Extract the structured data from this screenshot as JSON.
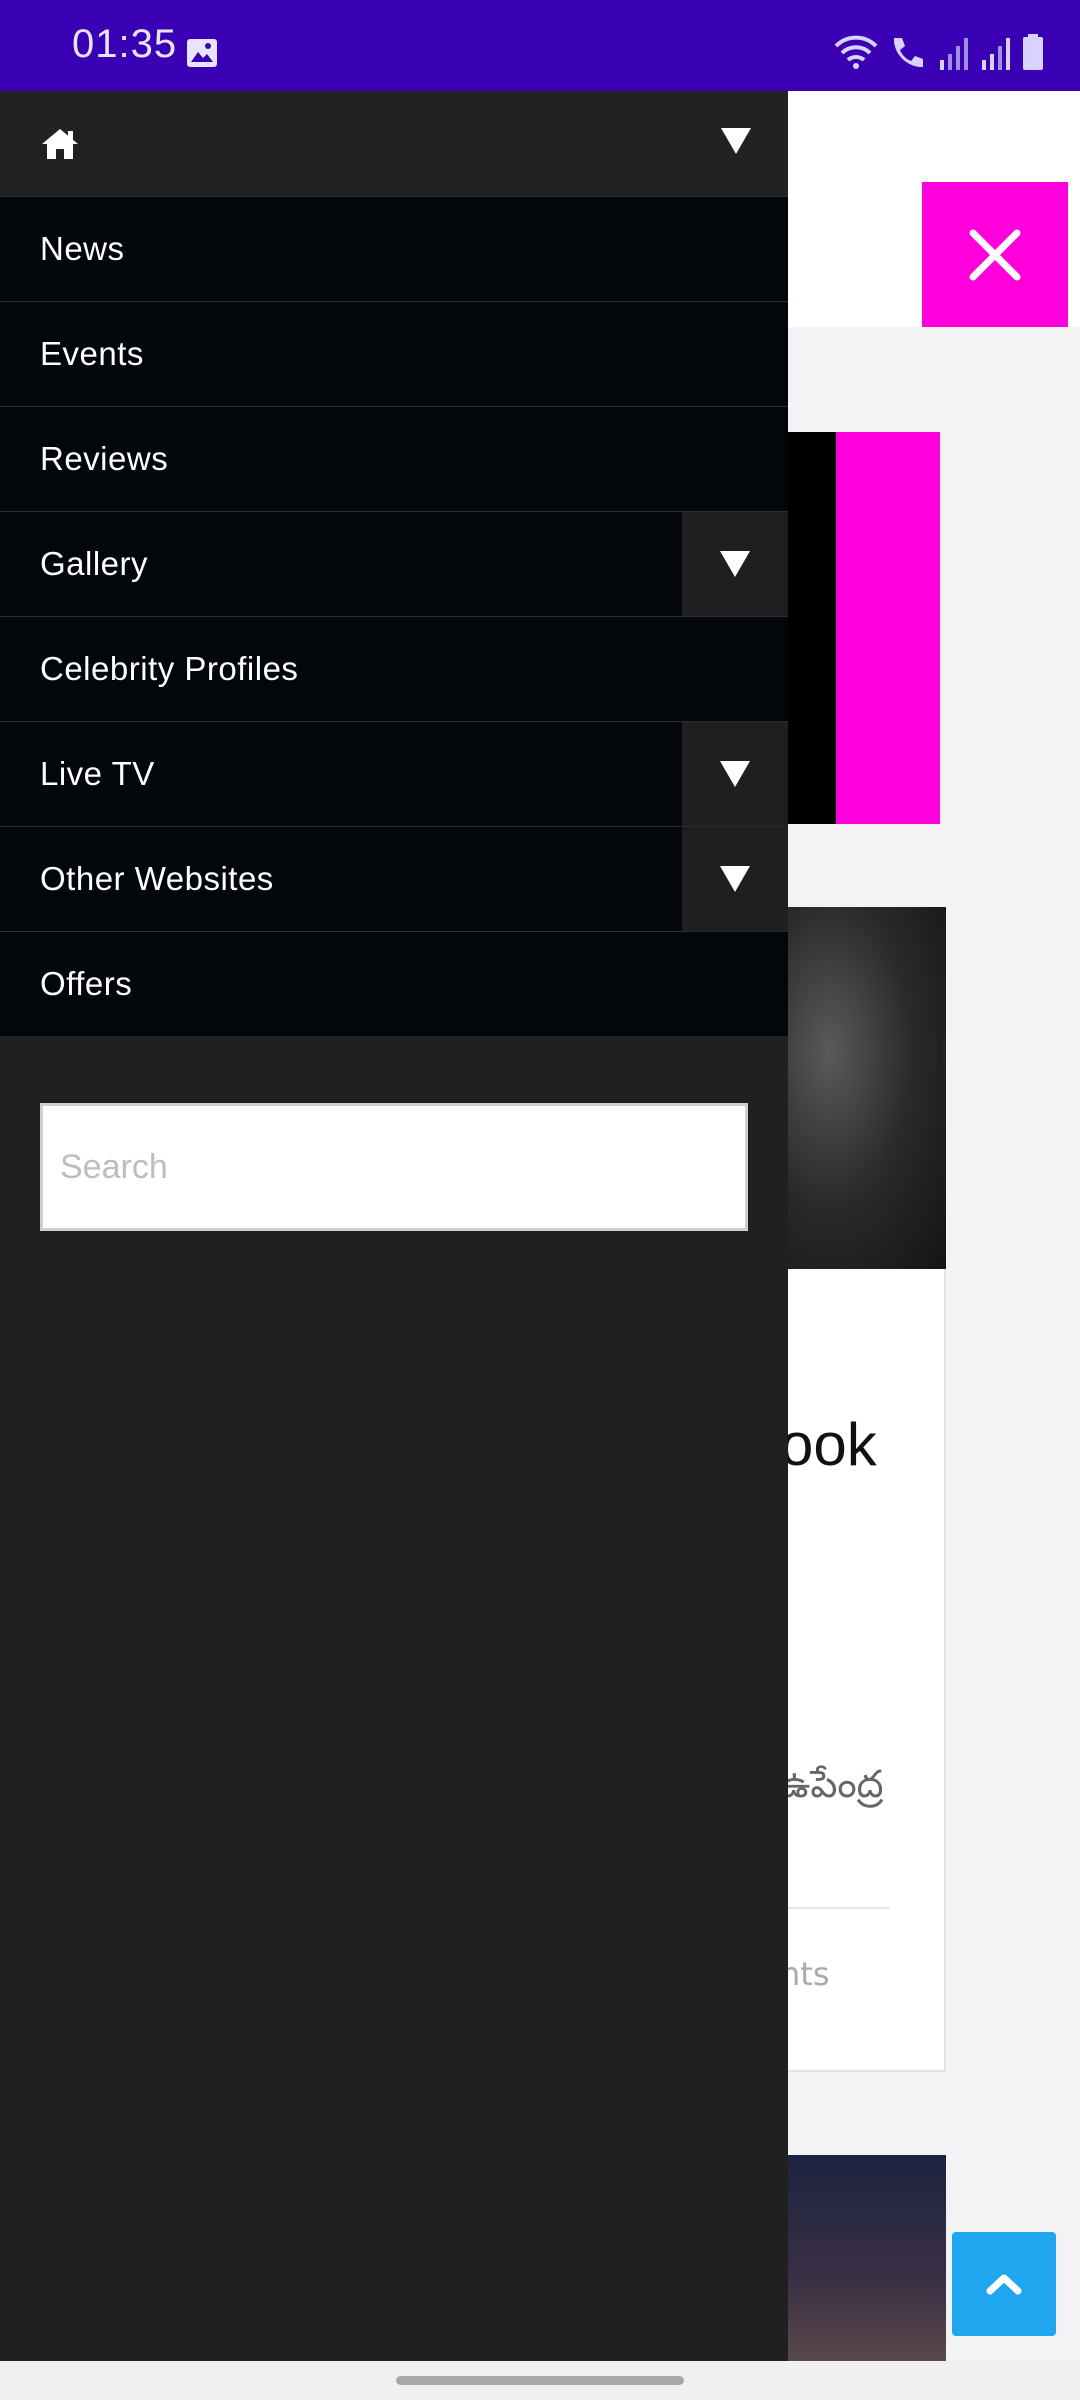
{
  "status_bar": {
    "time": "01:35",
    "icons": [
      "image-icon",
      "wifi-icon",
      "wifi-call-icon",
      "signal-icon",
      "signal-icon",
      "battery-icon"
    ],
    "bg_color": "#3a00b4"
  },
  "drawer": {
    "home_icon": "home-icon",
    "items": [
      {
        "label": "News",
        "has_submenu": false
      },
      {
        "label": "Events",
        "has_submenu": false
      },
      {
        "label": "Reviews",
        "has_submenu": false
      },
      {
        "label": "Gallery",
        "has_submenu": true
      },
      {
        "label": "Celebrity Profiles",
        "has_submenu": false
      },
      {
        "label": "Live TV",
        "has_submenu": true
      },
      {
        "label": "Other Websites",
        "has_submenu": true
      },
      {
        "label": "Offers",
        "has_submenu": false
      }
    ],
    "search": {
      "placeholder": "Search",
      "value": ""
    }
  },
  "background": {
    "close_icon": "close-icon",
    "accent_color": "#ff00dd",
    "partial_title": "ook",
    "partial_telugu": "ఉపేంద్ర",
    "partial_meta": "nts",
    "scroll_top_color": "#20a6ee"
  }
}
